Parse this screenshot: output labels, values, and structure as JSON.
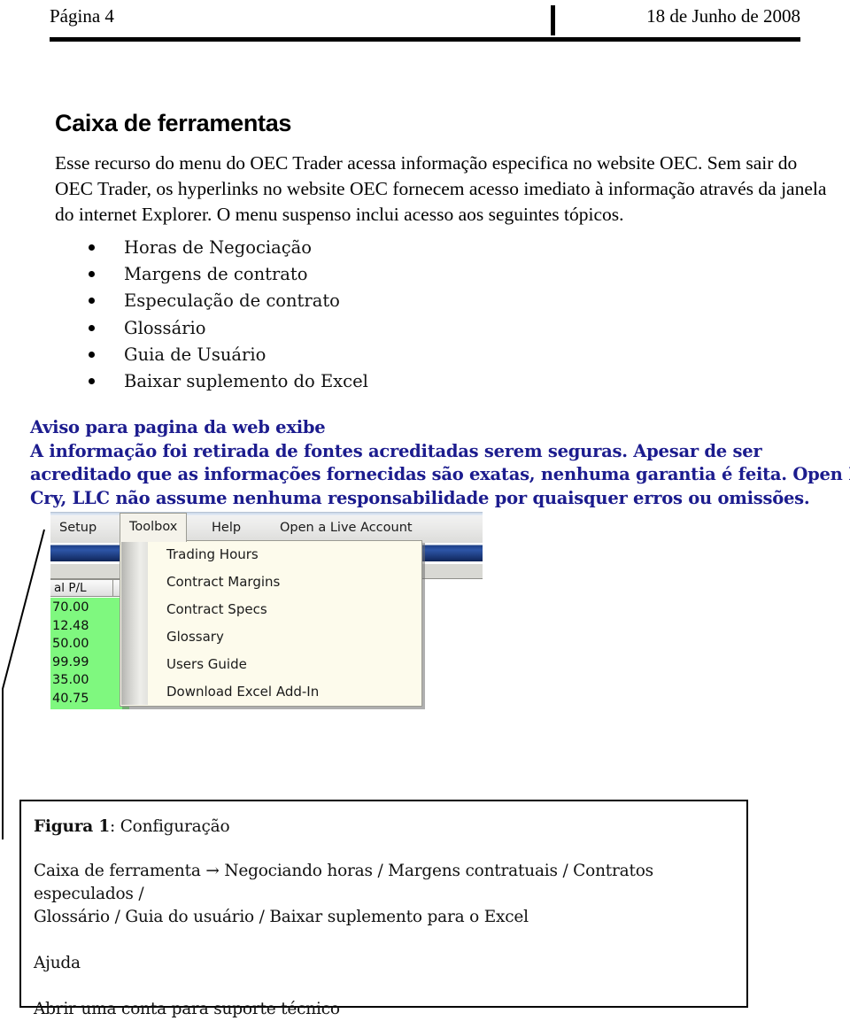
{
  "header": {
    "page_label": "Página 4",
    "date": "18 de Junho de 2008"
  },
  "section": {
    "title": "Caixa de ferramentas",
    "intro": "Esse recurso do menu do OEC Trader acessa informação especifica no website OEC. Sem sair do OEC Trader, os hyperlinks no website OEC fornecem acesso imediato à informação através da janela do internet Explorer. O menu suspenso inclui acesso aos seguintes tópicos."
  },
  "topics": [
    {
      "label": "Horas de Negociação"
    },
    {
      "label": "Margens de contrato"
    },
    {
      "label": "Especulação de contrato"
    },
    {
      "label": "Glossário"
    },
    {
      "label": "Guia de Usuário"
    },
    {
      "label": "Baixar suplemento do Excel"
    }
  ],
  "notice": {
    "color": "#1c1c8e",
    "line1": "Aviso para pagina da web exibe",
    "line2": "A informação foi retirada de fontes acreditadas serem seguras. Apesar de ser",
    "line3": "acreditado que as informações fornecidas são exatas, nenhuma garantia é feita. Open E",
    "line4": "Cry, LLC não assume nenhuma responsabilidade por quaisquer erros ou omissões."
  },
  "screenshot": {
    "menubar": {
      "setup": "Setup",
      "toolbox": "Toolbox",
      "help": "Help",
      "open_live_account": "Open a Live Account"
    },
    "dropdown": {
      "items": [
        {
          "label": "Trading Hours"
        },
        {
          "label": "Contract Margins"
        },
        {
          "label": "Contract Specs"
        },
        {
          "label": "Glossary"
        },
        {
          "label": "Users Guide"
        },
        {
          "label": "Download Excel Add-In"
        }
      ]
    },
    "grid": {
      "header": {
        "pl": "al P/L",
        "currency": "$"
      },
      "green_color": "#7ff87f",
      "values": [
        "70.00",
        "12.48",
        "50.00",
        "99.99",
        "35.00",
        "40.75"
      ]
    },
    "titlebar_color": "#1f3f86"
  },
  "caption": {
    "figure_label": "Figura 1",
    "figure_title": ": Configuração",
    "path_line1": "Caixa de ferramenta → Negociando horas / Margens contratuais / Contratos especulados /",
    "path_line2": "Glossário / Guia do usuário / Baixar suplemento para o Excel",
    "help": "Ajuda",
    "support": "Abrir uma conta para suporte técnico"
  }
}
